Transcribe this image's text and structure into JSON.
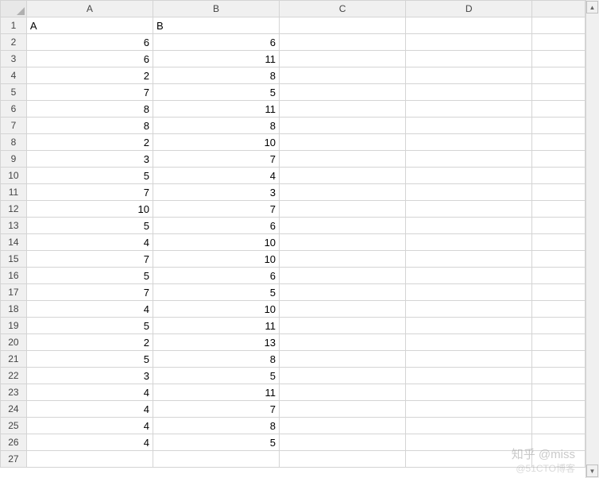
{
  "columns": [
    "A",
    "B",
    "C",
    "D",
    ""
  ],
  "row_count": 27,
  "header_row": {
    "A": "A",
    "B": "B"
  },
  "data": {
    "A": [
      6,
      6,
      2,
      7,
      8,
      8,
      2,
      3,
      5,
      7,
      10,
      5,
      4,
      7,
      5,
      7,
      4,
      5,
      2,
      5,
      3,
      4,
      4,
      4,
      4
    ],
    "B": [
      6,
      11,
      8,
      5,
      11,
      8,
      10,
      7,
      4,
      3,
      7,
      6,
      10,
      10,
      6,
      5,
      10,
      11,
      13,
      8,
      5,
      11,
      7,
      8,
      5
    ]
  },
  "watermark": {
    "line1": "知乎 @miss",
    "line2": "@51CTO博客"
  }
}
